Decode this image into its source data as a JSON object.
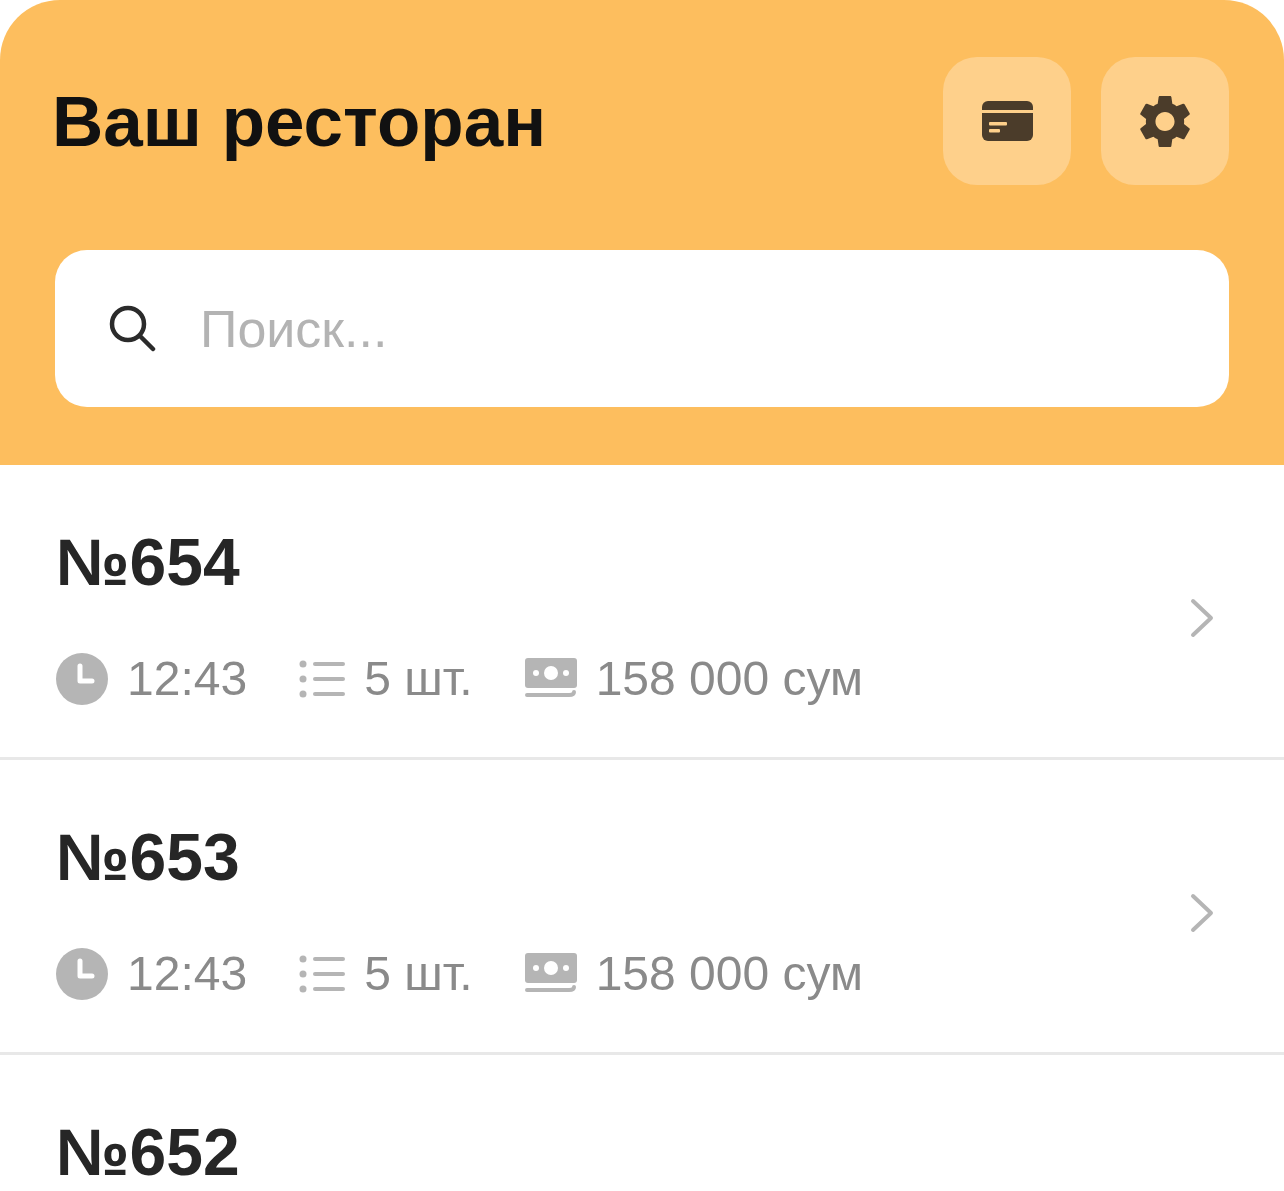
{
  "header": {
    "title": "Ваш ресторан",
    "search": {
      "placeholder": "Поиск..."
    }
  },
  "orders": [
    {
      "number": "№654",
      "time": "12:43",
      "items": "5 шт.",
      "total": "158 000 сум"
    },
    {
      "number": "№653",
      "time": "12:43",
      "items": "5 шт.",
      "total": "158 000 сум"
    },
    {
      "number": "№652"
    }
  ]
}
